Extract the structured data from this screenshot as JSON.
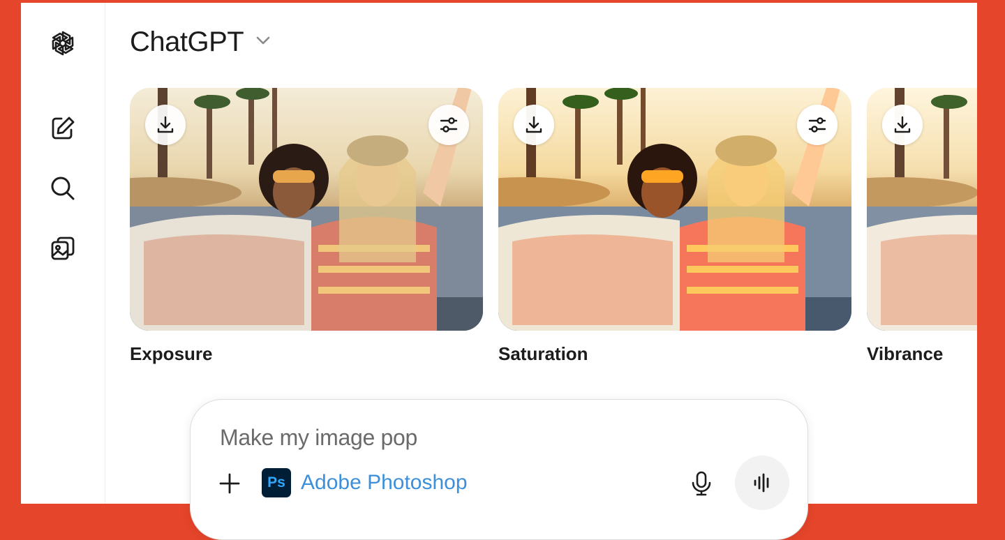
{
  "header": {
    "model_name": "ChatGPT"
  },
  "sidebar": {
    "items": [
      {
        "name": "logo",
        "icon": "openai-logo-icon"
      },
      {
        "name": "new-chat",
        "icon": "edit-icon"
      },
      {
        "name": "search",
        "icon": "search-icon"
      },
      {
        "name": "library",
        "icon": "images-icon"
      }
    ]
  },
  "carousel": {
    "cards": [
      {
        "label": "Exposure"
      },
      {
        "label": "Saturation"
      },
      {
        "label": "Vibrance"
      }
    ]
  },
  "composer": {
    "prompt_text": "Make my image pop",
    "connector": {
      "badge": "Ps",
      "name": "Adobe Photoshop",
      "color": "#3d8fd9"
    }
  },
  "colors": {
    "frame": "#e5452a",
    "ps_bg": "#001e36",
    "ps_fg": "#31a8ff"
  }
}
